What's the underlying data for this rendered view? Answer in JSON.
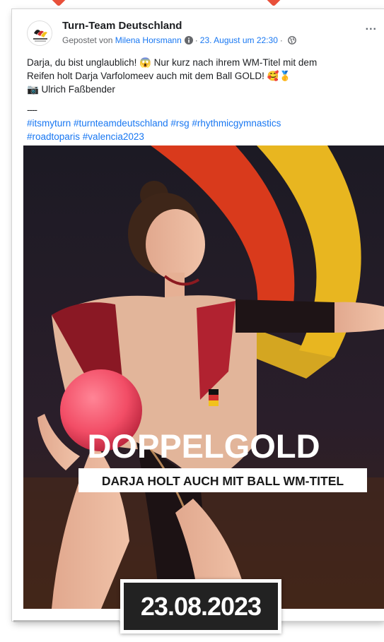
{
  "post": {
    "page_name": "Turn-Team Deutschland",
    "posted_by_prefix": "Gepostet von",
    "author": "Milena Horsmann",
    "separator": "·",
    "date": "23. August um 22:30",
    "more_label": "...",
    "text_line1": "Darja, du bist unglaublich! 😱 Nur kurz nach ihrem WM-Titel mit dem",
    "text_line2": "Reifen holt Darja Varfolomeev auch mit dem Ball GOLD! 🥰🥇",
    "credit": "📷 Ulrich Faßbender",
    "divider": "----",
    "hashtags_line1": "#itsmyturn #turnteamdeutschland #rsg #rhythmicgymnastics",
    "hashtags_line2": "#roadtoparis #valencia2023"
  },
  "image": {
    "headline": "DOPPELGOLD",
    "subline": "DARJA HOLT AUCH MIT BALL WM-TITEL"
  },
  "badge": {
    "date": "23.08.2023"
  },
  "colors": {
    "accent_marker": "#e8503a",
    "link_blue": "#1877f2",
    "ball_pink": "#ff5a70",
    "ribbon_red": "#d93a1c",
    "ribbon_gold": "#e8b620"
  },
  "icons": {
    "info": "info-icon",
    "audience": "globe-icon",
    "more": "more-options-icon"
  }
}
